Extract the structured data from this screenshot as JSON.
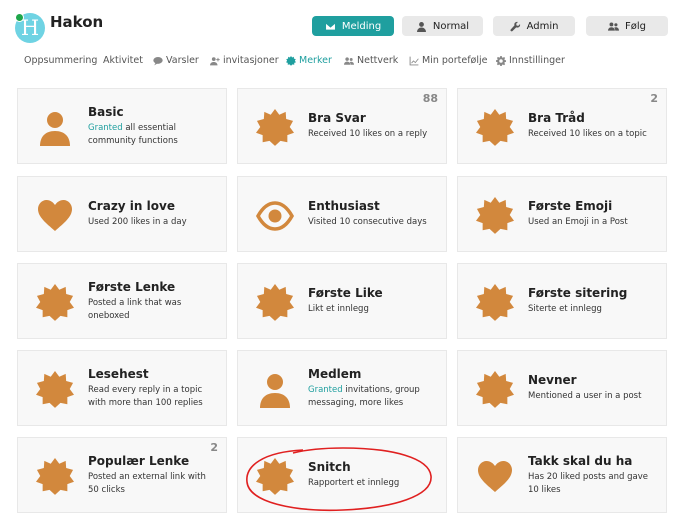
{
  "user": {
    "avatar_letter": "H",
    "name": "Hakon"
  },
  "header_buttons": {
    "message": "Melding",
    "normal": "Normal",
    "admin": "Admin",
    "follow": "Følg"
  },
  "nav": [
    "Oppsummering",
    "Aktivitet",
    "Varsler",
    "invitasjoner",
    "Merker",
    "Nettverk",
    "Min portefølje",
    "Innstillinger"
  ],
  "badges": [
    {
      "name": "Basic",
      "desc_granted": "Granted",
      "desc": " all essential community functions",
      "count": ""
    },
    {
      "name": "Bra Svar",
      "desc_granted": "",
      "desc": "Received 10 likes on a reply",
      "count": "88"
    },
    {
      "name": "Bra Tråd",
      "desc_granted": "",
      "desc": "Received 10 likes on a topic",
      "count": "2"
    },
    {
      "name": "Crazy in love",
      "desc_granted": "",
      "desc": "Used 200 likes in a day",
      "count": ""
    },
    {
      "name": "Enthusiast",
      "desc_granted": "",
      "desc": "Visited 10 consecutive days",
      "count": ""
    },
    {
      "name": "Første Emoji",
      "desc_granted": "",
      "desc": "Used an Emoji in a Post",
      "count": ""
    },
    {
      "name": "Første Lenke",
      "desc_granted": "",
      "desc": "Posted a link that was oneboxed",
      "count": ""
    },
    {
      "name": "Første Like",
      "desc_granted": "",
      "desc": "Likt et innlegg",
      "count": ""
    },
    {
      "name": "Første sitering",
      "desc_granted": "",
      "desc": "Siterte et innlegg",
      "count": ""
    },
    {
      "name": "Lesehest",
      "desc_granted": "",
      "desc": "Read every reply in a topic with more than 100 replies",
      "count": ""
    },
    {
      "name": "Medlem",
      "desc_granted": "Granted",
      "desc": " invitations, group messaging, more likes",
      "count": ""
    },
    {
      "name": "Nevner",
      "desc_granted": "",
      "desc": "Mentioned a user in a post",
      "count": ""
    },
    {
      "name": "Populær Lenke",
      "desc_granted": "",
      "desc": "Posted an external link with 50 clicks",
      "count": "2"
    },
    {
      "name": "Snitch",
      "desc_granted": "",
      "desc": "Rapportert et innlegg",
      "count": ""
    },
    {
      "name": "Takk skal du ha",
      "desc_granted": "",
      "desc": "Has 20 liked posts and gave 10 likes",
      "count": ""
    }
  ],
  "colors": {
    "accent": "#1f9f9f",
    "badge": "#d2883d",
    "annotation": "#e02020"
  }
}
